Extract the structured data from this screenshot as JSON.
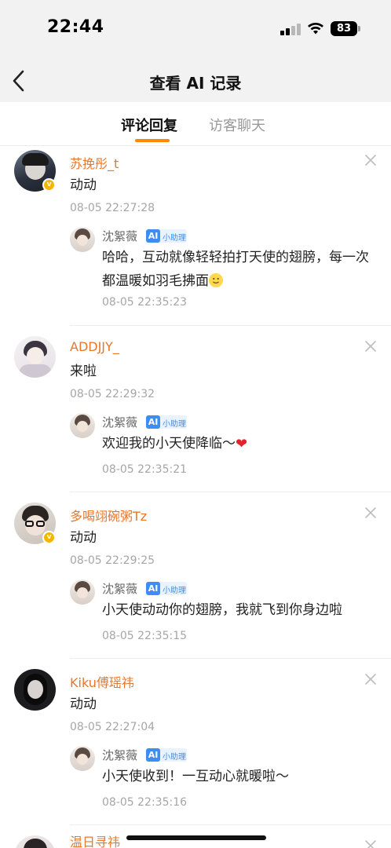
{
  "status_bar": {
    "time": "22:44",
    "battery": "83"
  },
  "nav": {
    "title": "查看 AI 记录"
  },
  "tabs": [
    {
      "label": "评论回复",
      "active": true
    },
    {
      "label": "访客聊天",
      "active": false
    }
  ],
  "comments": [
    {
      "username": "苏挽彤_t",
      "text": "动动",
      "time": "08-05 22:27:28",
      "verified": true,
      "reply": {
        "name": "沈絮薇",
        "ai_tag": "小助理",
        "text": "哈哈，互动就像轻轻拍打天使的翅膀，每一次都温暖如羽毛拂面",
        "emoji": "slight-smile",
        "time": "08-05 22:35:23"
      }
    },
    {
      "username": "ADDJJY_",
      "text": "来啦",
      "time": "08-05 22:29:32",
      "verified": false,
      "reply": {
        "name": "沈絮薇",
        "ai_tag": "小助理",
        "text": "欢迎我的小天使降临～",
        "emoji": "heart",
        "time": "08-05 22:35:21"
      }
    },
    {
      "username": "多喝翊碗粥Tz",
      "text": "动动",
      "time": "08-05 22:29:25",
      "verified": true,
      "reply": {
        "name": "沈絮薇",
        "ai_tag": "小助理",
        "text": "小天使动动你的翅膀，我就飞到你身边啦",
        "time": "08-05 22:35:15"
      }
    },
    {
      "username": "Kiku傅瑶祎",
      "text": "动动",
      "time": "08-05 22:27:04",
      "verified": false,
      "reply": {
        "name": "沈絮薇",
        "ai_tag": "小助理",
        "text": "小天使收到！一互动心就暖啦～",
        "time": "08-05 22:35:16"
      }
    },
    {
      "username": "温日寻祎"
    }
  ],
  "colors": {
    "accent": "#ff8a00",
    "username": "#e8772a",
    "ai_blue": "#3d8df5",
    "verified": "#f7b500"
  },
  "icons": {
    "back": "chevron-left-icon",
    "close": "close-icon"
  }
}
